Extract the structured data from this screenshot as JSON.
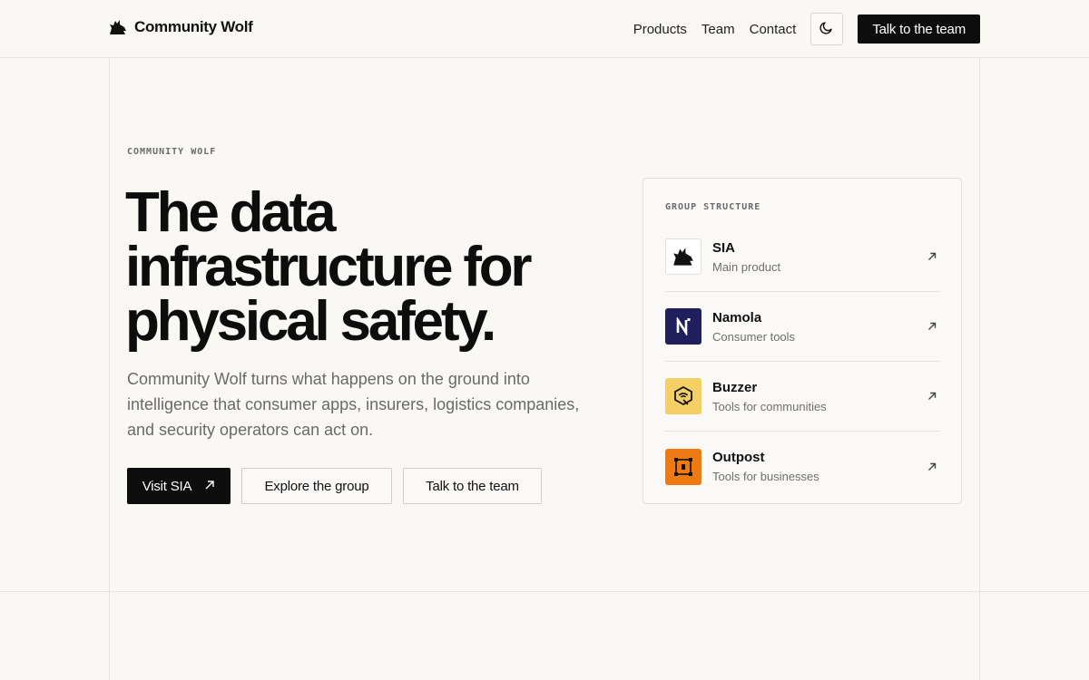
{
  "header": {
    "brand": "Community Wolf",
    "nav": [
      "Products",
      "Team",
      "Contact"
    ],
    "cta": "Talk to the team"
  },
  "hero": {
    "eyebrow": "COMMUNITY WOLF",
    "headline": "The data infrastructure for physical safety.",
    "subtext": "Community Wolf turns what happens on the ground into intelligence that consumer apps, insurers, logistics companies, and security operators can act on.",
    "primary_button": "Visit SIA",
    "explore_button": "Explore the group",
    "talk_button": "Talk to the team"
  },
  "group": {
    "title": "GROUP STRUCTURE",
    "items": [
      {
        "name": "SIA",
        "desc": "Main product",
        "icon": "wolf-icon"
      },
      {
        "name": "Namola",
        "desc": "Consumer tools",
        "icon": "namola-n-icon",
        "color": "#1f1f5e"
      },
      {
        "name": "Buzzer",
        "desc": "Tools for communities",
        "icon": "buzzer-icon",
        "color": "#f4cf63"
      },
      {
        "name": "Outpost",
        "desc": "Tools for businesses",
        "icon": "outpost-icon",
        "color": "#f07a12"
      }
    ]
  }
}
